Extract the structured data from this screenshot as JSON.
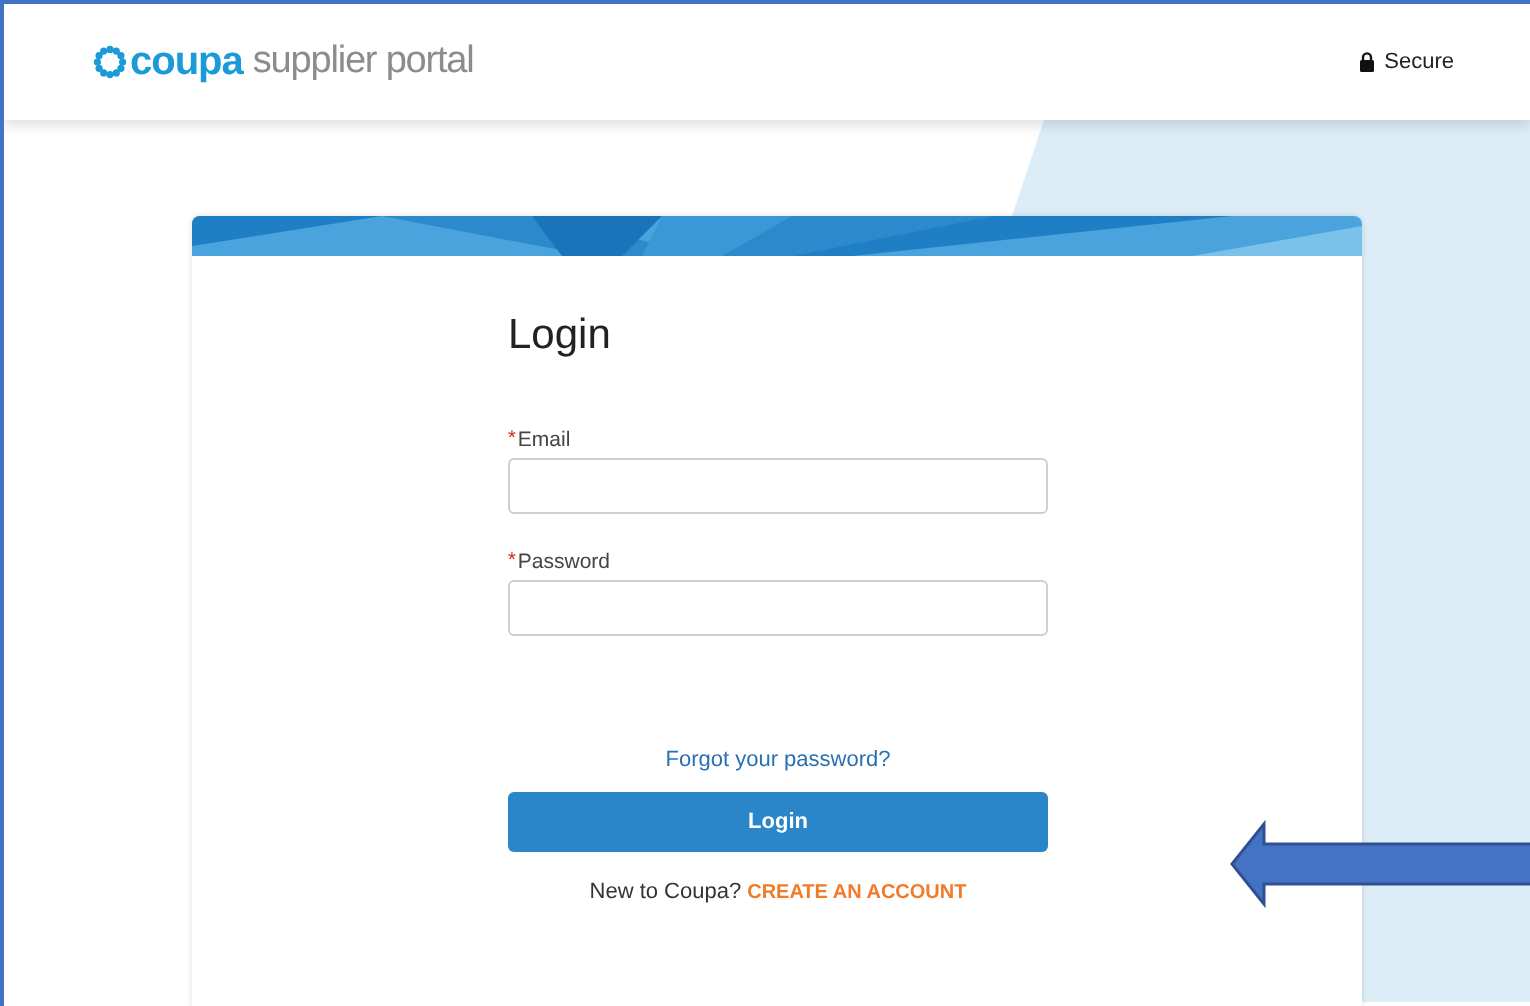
{
  "header": {
    "logo_brand": "coupa",
    "logo_product": "supplier portal",
    "secure_label": "Secure"
  },
  "login": {
    "title": "Login",
    "fields": [
      {
        "label": "Email",
        "required_mark": "*"
      },
      {
        "label": "Password",
        "required_mark": "*"
      }
    ],
    "forgot_link": "Forgot your password?",
    "submit_button": "Login",
    "signup_prompt": "New to Coupa?",
    "signup_link": "CREATE AN ACCOUNT"
  }
}
